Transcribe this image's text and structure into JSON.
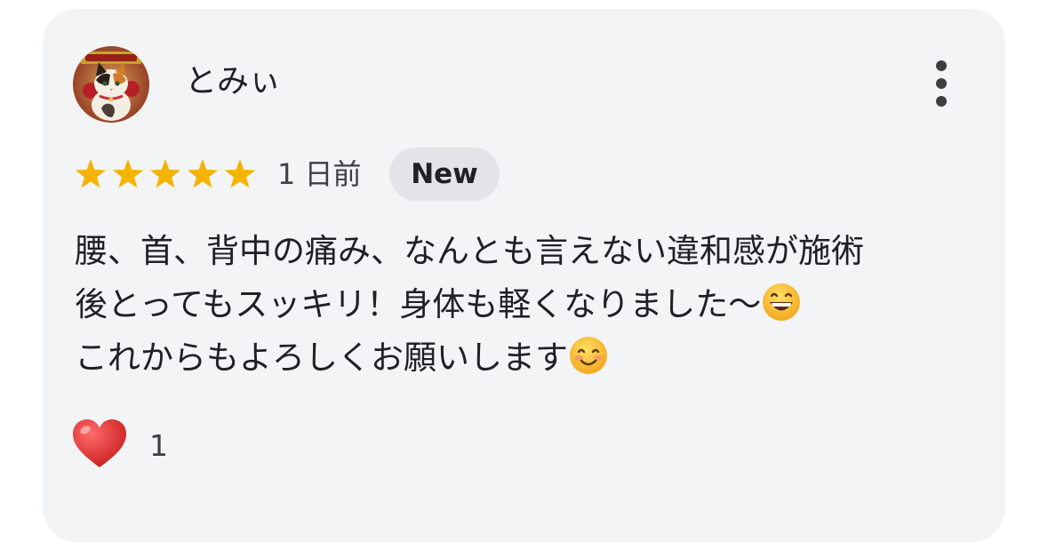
{
  "review": {
    "author": "とみぃ",
    "avatar_icon": "calico-cat-avatar",
    "menu_icon": "more-vert-icon",
    "rating": 5,
    "rating_max": 5,
    "star_color": "#f4b400",
    "date": "1 日前",
    "badge": "New",
    "body_lines": [
      "腰、首、背中の痛み、なんとも言えない違和感が施術",
      "後とってもスッキリ！身体も軽くなりました〜",
      "これからもよろしくお願いします"
    ],
    "line2_emoji": "grinning-face-icon",
    "line3_emoji": "smiling-face-icon",
    "reaction": {
      "icon": "heart-icon",
      "count": "1",
      "color": "#d62b2b"
    }
  }
}
